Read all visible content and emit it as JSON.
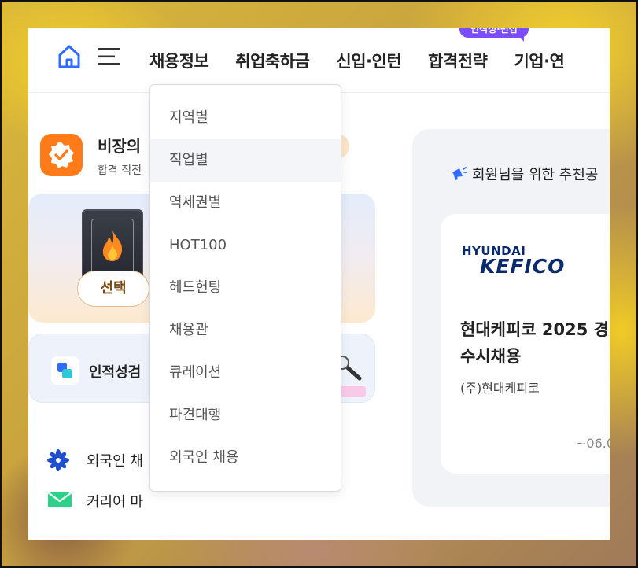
{
  "header": {
    "nav": [
      "채용정보",
      "취업축하금",
      "신입·인턴",
      "합격전략",
      "기업·연"
    ],
    "badge": "인적성·면접"
  },
  "vip": {
    "title": "비장의",
    "subtitle": "합격 직전"
  },
  "ticket": {
    "select_label": "선택"
  },
  "test_card": {
    "label": "인적성검"
  },
  "links": [
    {
      "icon": "flower-icon",
      "label": "외국인 채"
    },
    {
      "icon": "mail-icon",
      "label": "커리어 마"
    }
  ],
  "recommend": {
    "title": "회원님을 위한 추천공",
    "logo_line1": "HYUNDAI",
    "logo_line2": "KEFICO",
    "job_title_line1": "현대케피코 2025 경",
    "job_title_line2": "수시채용",
    "company": "(주)현대케피코",
    "deadline": "~06.0"
  },
  "dropdown": {
    "items": [
      "지역별",
      "직업별",
      "역세권별",
      "HOT100",
      "헤드헌팅",
      "채용관",
      "큐레이션",
      "파견대행",
      "외국인 채용"
    ],
    "active_index": 1
  },
  "colors": {
    "accent_blue": "#2f6bff",
    "badge_purple": "#7b4dff",
    "vip_orange": "#ff7a18"
  }
}
